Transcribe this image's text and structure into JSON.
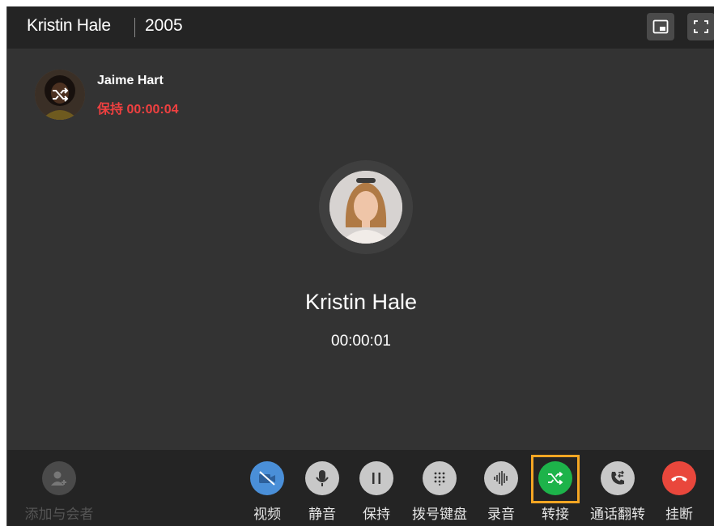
{
  "titlebar": {
    "name": "Kristin Hale",
    "extension": "2005",
    "pip_icon": "picture-in-picture-icon",
    "fullscreen_icon": "fullscreen-icon"
  },
  "held_call": {
    "name": "Jaime Hart",
    "status": "保持 00:00:04",
    "status_color": "#f04040",
    "overlay_icon": "transfer-shuffle-icon"
  },
  "active_call": {
    "name": "Kristin Hale",
    "timer": "00:00:01"
  },
  "controls": {
    "add_conference": {
      "label": "添加与会者",
      "icon": "add-person-icon"
    },
    "video": {
      "label": "视频",
      "icon": "video-off-icon"
    },
    "mute": {
      "label": "静音",
      "icon": "microphone-icon"
    },
    "hold": {
      "label": "保持",
      "icon": "pause-icon"
    },
    "dialpad": {
      "label": "拨号键盘",
      "icon": "dialpad-icon"
    },
    "record": {
      "label": "录音",
      "icon": "waveform-icon"
    },
    "transfer": {
      "label": "转接",
      "icon": "transfer-shuffle-icon"
    },
    "flip": {
      "label": "通话翻转",
      "icon": "call-flip-icon"
    },
    "hangup": {
      "label": "挂断",
      "icon": "hangup-icon"
    }
  },
  "colors": {
    "accent_green": "#1db34a",
    "hangup_red": "#e9473c",
    "highlight": "#f5a623"
  }
}
